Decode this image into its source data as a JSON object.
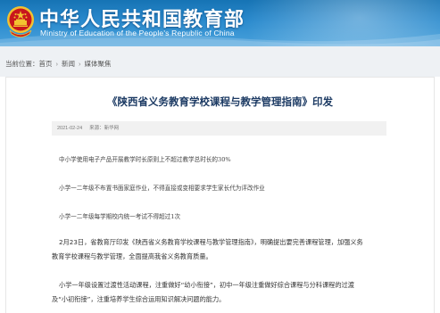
{
  "header": {
    "title": "中华人民共和国教育部",
    "subtitle": "Ministry of Education of the People's Republic of China"
  },
  "breadcrumb": {
    "prefix": "当前位置：",
    "items": [
      "首页",
      "新闻",
      "媒体聚焦"
    ],
    "separator": "›"
  },
  "article": {
    "title": "《陕西省义务教育学校课程与教学管理指南》印发",
    "date": "2021-02-24",
    "source_label": "来源：",
    "source": "新华网",
    "highlights": [
      "中小学使用电子产品开展教学时长原则上不超过教学总时长的30%",
      "小学一二年级不布置书面家庭作业，不得直接或变相要求学生家长代为评改作业",
      "小学一二年级每学期校内统一考试不得超过1次"
    ],
    "paragraphs": [
      {
        "line1": "2月23日，省教育厅印发《陕西省义务教育学校课程与教学管理指南》，明确提出要完善课程管理，加强义务",
        "line2": "教育学校课程与教学管理，全面提高我省义务教育质量。"
      },
      {
        "line1": "小学一年级设置过渡性活动课程，注重做好“幼小衔接”，初中一年级注重做好综合课程与分科课程的过渡",
        "line2": "及“小初衔接”，注重培养学生综合运用知识解决问题的能力。"
      }
    ]
  },
  "colors": {
    "header_blue": "#1673b4",
    "title_navy": "#1d3b64",
    "emblem_red": "#c8161d",
    "emblem_gold": "#f2c230"
  }
}
